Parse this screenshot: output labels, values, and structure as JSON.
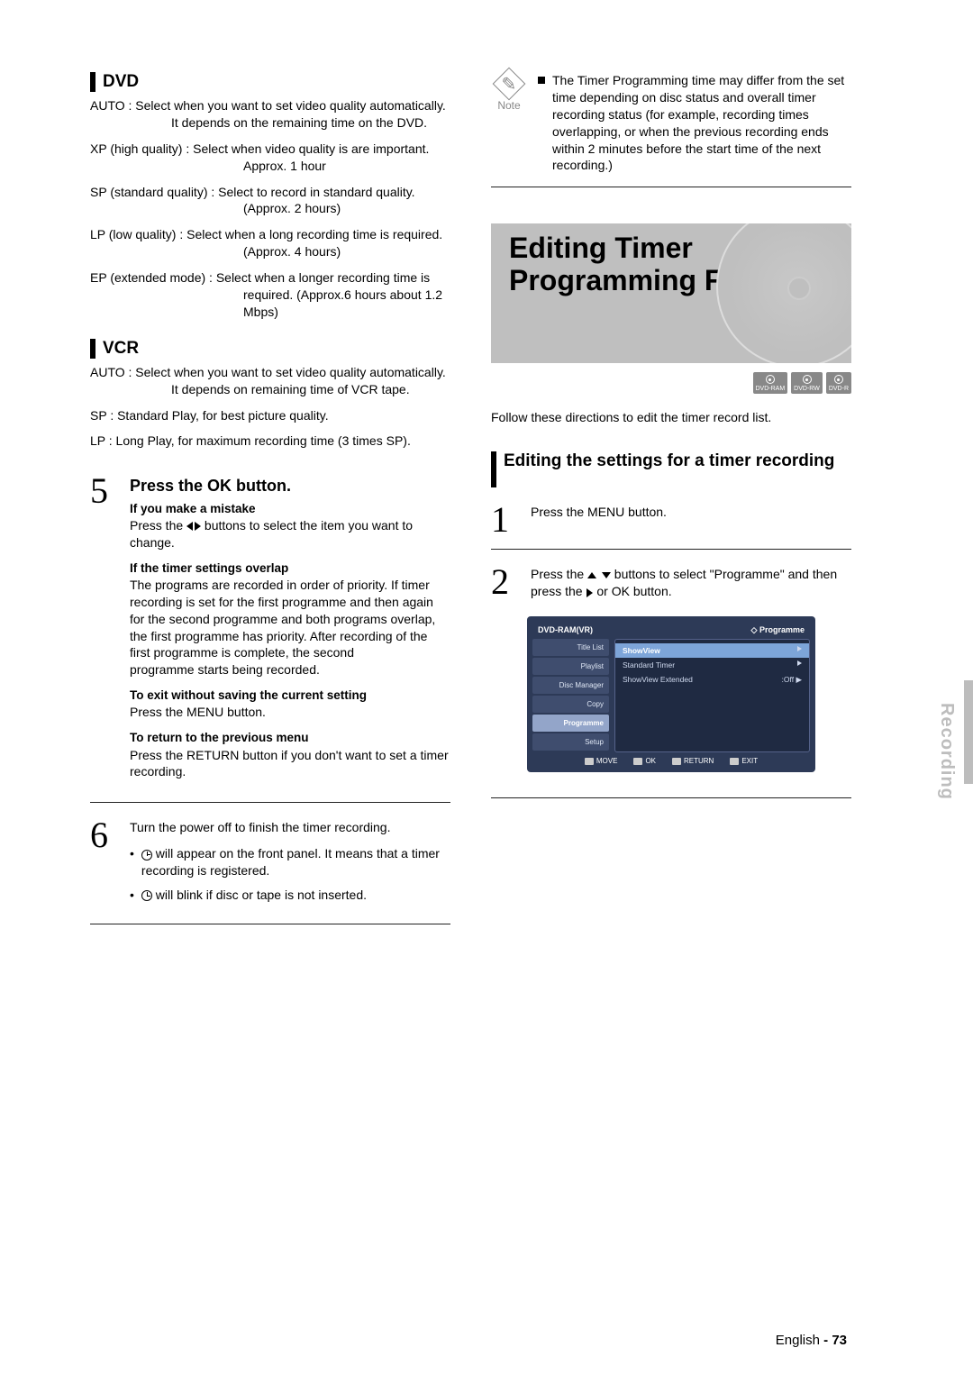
{
  "left": {
    "dvd": {
      "title": "DVD",
      "items": [
        "AUTO : Select when you want to set video quality automatically. It depends on the remaining time on the DVD.",
        "XP (high quality) : Select when video quality is are important. Approx. 1 hour",
        "SP (standard quality) : Select to record in standard quality. (Approx. 2 hours)",
        "LP (low quality) : Select when a long recording time is required.(Approx. 4 hours)",
        "EP (extended mode) : Select when a longer recording time is required. (Approx.6 hours about 1.2 Mbps)"
      ]
    },
    "vcr": {
      "title": "VCR",
      "items": [
        "AUTO : Select when you want to set video quality automatically. It depends on remaining time of VCR tape.",
        "SP : Standard Play, for best picture quality.",
        "LP : Long Play, for maximum recording time (3 times SP)."
      ]
    },
    "step5": {
      "num": "5",
      "title": "Press the OK button.",
      "mistake_h": "If you make a mistake",
      "mistake_t": "Press the ◀ ▶ buttons to select the item you want to change.",
      "overlap_h": "If the timer settings overlap",
      "overlap_t": "The programs are recorded in order of priority. If timer recording is set for the first programme and then again for the second programme and both programs overlap, the first programme has priority. After recording of the first programme is complete, the second",
      "overlap_t2": "programme starts being recorded.",
      "exit_h": "To exit without saving the current setting",
      "exit_t": "Press the MENU button.",
      "return_h": "To return to the previous menu",
      "return_t": "Press the RETURN button if you don't want to set a timer recording."
    },
    "step6": {
      "num": "6",
      "line1": "Turn the power off to finish the timer recording.",
      "b1a": " will appear on the front panel. It means that a timer recording is registered.",
      "b2a": " will blink if disc or tape is not inserted."
    }
  },
  "right": {
    "note": {
      "label": "Note",
      "text": "The Timer Programming time may differ from the set time depending on disc status and overall timer recording status (for example, recording times overlapping, or when the previous recording ends within 2 minutes before the start time of the next recording.)"
    },
    "feature_title1": "Editing Timer",
    "feature_title2": "Programming Feature",
    "badges": [
      "DVD-RAM",
      "DVD-RW",
      "DVD-R"
    ],
    "intro": "Follow these directions to edit the timer record list.",
    "sub_title": "Editing the settings for a timer recording",
    "step1": {
      "num": "1",
      "text": "Press the MENU button."
    },
    "step2": {
      "num": "2",
      "text": "Press the ▲ ▼ buttons to select \"Programme\" and then press the ▶ or OK button."
    },
    "osd": {
      "top_left": "DVD-RAM(VR)",
      "top_right": "Programme",
      "menu": [
        "Title List",
        "Playlist",
        "Disc Manager",
        "Copy",
        "Programme",
        "Setup"
      ],
      "active_index": 4,
      "panel": [
        {
          "l": "ShowView",
          "r": "▶"
        },
        {
          "l": "Standard Timer",
          "r": "▶"
        },
        {
          "l": "ShowView Extended",
          "r": ":Off    ▶"
        }
      ],
      "footer": [
        "MOVE",
        "OK",
        "RETURN",
        "EXIT"
      ]
    }
  },
  "side_tab": "Recording",
  "footer_lang": "English",
  "footer_page": "73"
}
